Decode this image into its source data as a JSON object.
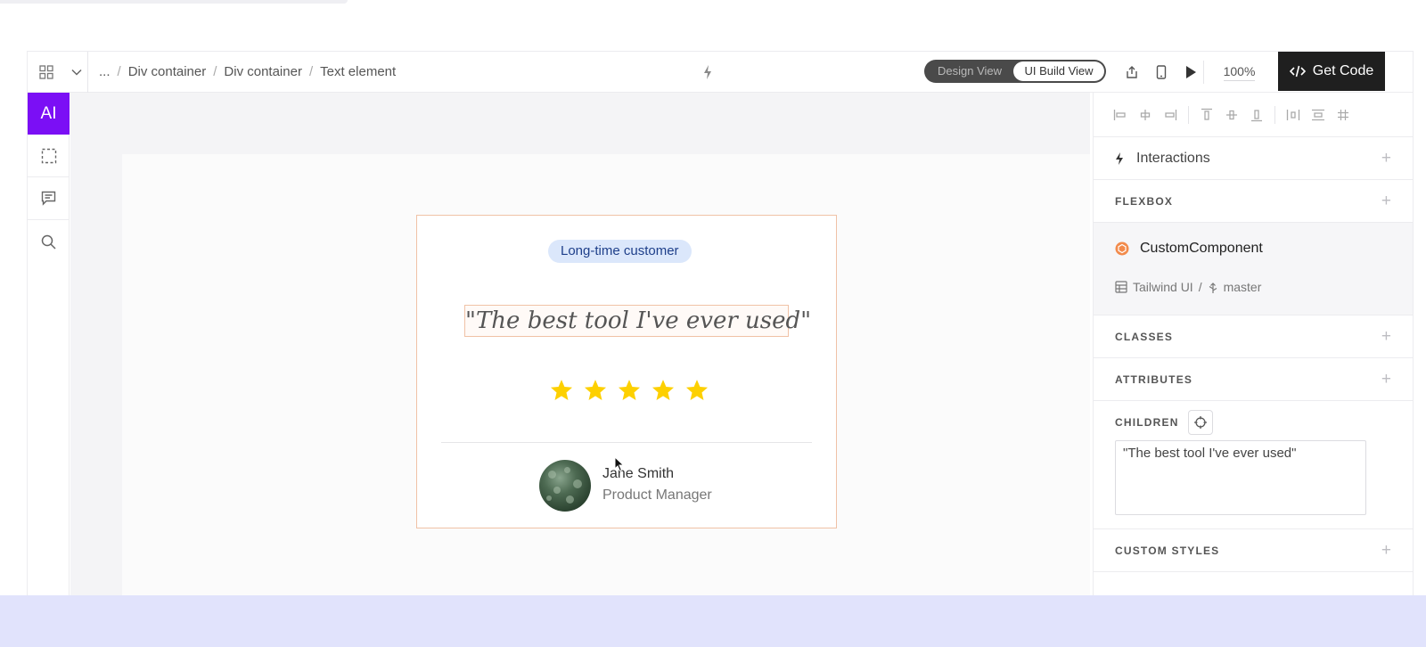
{
  "colors": {
    "ai_accent": "#7b0ff5",
    "star": "#fdd000",
    "badge_bg": "#dbe7fb",
    "badge_text": "#1e3f8a",
    "selection_outline": "#f0c2a6",
    "get_code_bg": "#1f1f1f",
    "page_band": "#e1e3fc"
  },
  "topbar": {
    "breadcrumbs": [
      "...",
      "Div container",
      "Div container",
      "Text element"
    ],
    "design_view": "Design View",
    "ui_build_view": "UI Build View",
    "zoom": "100%",
    "get_code": "Get Code"
  },
  "leftbar": {
    "ai_label": "AI",
    "icons": [
      "selection-icon",
      "comment-icon",
      "search-icon"
    ]
  },
  "card": {
    "badge": "Long-time customer",
    "quote": "\"The best tool I've ever used\"",
    "stars": 5,
    "name": "Jane Smith",
    "role": "Product Manager"
  },
  "panel": {
    "interactions": "Interactions",
    "flexbox": "FLEXBOX",
    "component_name": "CustomComponent",
    "library": "Tailwind UI",
    "branch": "master",
    "classes": "CLASSES",
    "attributes": "ATTRIBUTES",
    "children": "CHILDREN",
    "children_value": "\"The best tool I've ever used\"",
    "custom_styles": "CUSTOM STYLES"
  }
}
